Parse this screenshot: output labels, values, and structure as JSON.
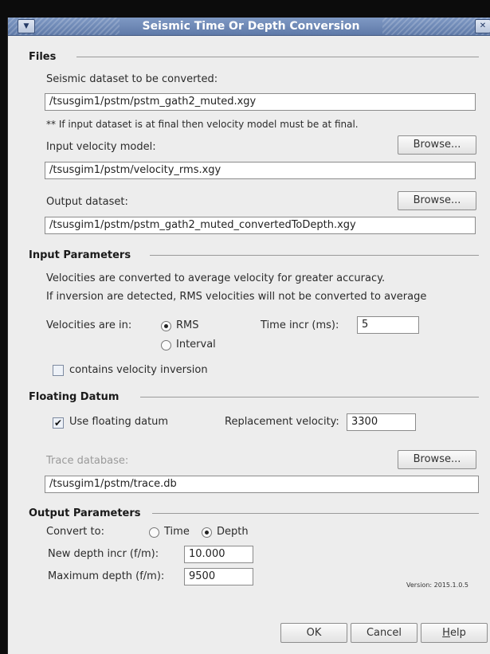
{
  "window": {
    "title": "Seismic Time Or Depth Conversion",
    "menu_icon": "chevron-down-icon",
    "close_icon": "close-icon",
    "menu_glyph": "▼",
    "close_glyph": "✕"
  },
  "files": {
    "heading": "Files",
    "seismic_label": "Seismic dataset to be converted:",
    "seismic_value": "/tsusgim1/pstm/pstm_gath2_muted.xgy",
    "note": "** If input dataset is at final then velocity model must be at final.",
    "velocity_label": "Input velocity model:",
    "velocity_browse": "Browse...",
    "velocity_value": "/tsusgim1/pstm/velocity_rms.xgy",
    "output_label": "Output dataset:",
    "output_browse": "Browse...",
    "output_value": "/tsusgim1/pstm/pstm_gath2_muted_convertedToDepth.xgy"
  },
  "input_params": {
    "heading": "Input Parameters",
    "info_line1": "Velocities are converted to average velocity for greater accuracy.",
    "info_line2": "If inversion are detected, RMS velocities will not be converted to average",
    "velocities_label": "Velocities are in:",
    "options": [
      {
        "label": "RMS",
        "selected": true
      },
      {
        "label": "Interval",
        "selected": false
      }
    ],
    "time_incr_label": "Time incr (ms):",
    "time_incr_value": "5",
    "inversion_label": "contains velocity inversion",
    "inversion_checked": false
  },
  "floating_datum": {
    "heading": "Floating Datum",
    "use_label": "Use floating datum",
    "use_checked": true,
    "check_glyph": "✔",
    "replacement_label": "Replacement velocity:",
    "replacement_value": "3300",
    "trace_label": "Trace database:",
    "trace_browse": "Browse...",
    "trace_value": "/tsusgim1/pstm/trace.db"
  },
  "output_params": {
    "heading": "Output Parameters",
    "convert_label": "Convert to:",
    "options": [
      {
        "label": "Time",
        "selected": false
      },
      {
        "label": "Depth",
        "selected": true
      }
    ],
    "depth_incr_label": "New depth incr (f/m):",
    "depth_incr_value": "10.000",
    "max_depth_label": "Maximum depth (f/m):",
    "max_depth_value": "9500"
  },
  "version": "Version: 2015.1.0.5",
  "buttons": {
    "ok": "OK",
    "cancel": "Cancel",
    "help_prefix": "H",
    "help_rest": "elp"
  }
}
